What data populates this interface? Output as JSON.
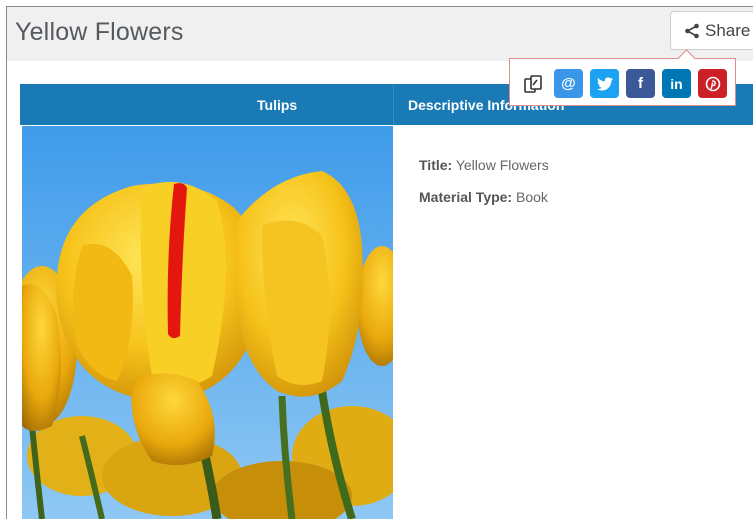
{
  "page": {
    "title": "Yellow Flowers"
  },
  "share": {
    "label": "Share"
  },
  "tabs": [
    {
      "label": "Tulips"
    },
    {
      "label": "Descriptive Information"
    }
  ],
  "details": {
    "title_label": "Title:",
    "title_value": "Yellow Flowers",
    "material_label": "Material Type:",
    "material_value": "Book"
  },
  "share_popup": {
    "icons": [
      "copy-link-icon",
      "email-icon",
      "twitter-icon",
      "facebook-icon",
      "linkedin-icon",
      "pinterest-icon"
    ]
  },
  "colors": {
    "tab_bar": "#1a7ab6",
    "email": "#3a96e8",
    "twitter": "#1da1f2",
    "facebook": "#3b5998",
    "linkedin": "#0077b5",
    "pinterest": "#cb2027"
  }
}
